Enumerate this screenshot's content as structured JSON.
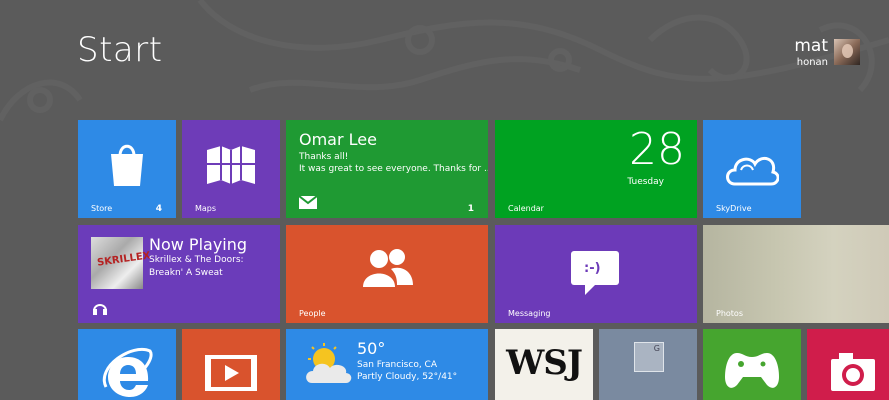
{
  "header": {
    "title": "Start",
    "user_name": "mat",
    "user_subtitle": "honan"
  },
  "tiles": {
    "store": {
      "label": "Store",
      "badge": "4"
    },
    "maps": {
      "label": "Maps"
    },
    "mail": {
      "sender": "Omar Lee",
      "subject": "Thanks all!",
      "preview": "It was great to see everyone. Thanks for ...",
      "badge": "1"
    },
    "calendar": {
      "label": "Calendar",
      "date": "28",
      "day": "Tuesday"
    },
    "skydrive": {
      "label": "SkyDrive"
    },
    "music": {
      "title": "Now Playing",
      "artist": "Skrillex & The Doors:",
      "track": "Breakn' A Sweat",
      "album_text": "SKRILLEX"
    },
    "people": {
      "label": "People"
    },
    "messaging": {
      "label": "Messaging",
      "emoticon": ":-)"
    },
    "photos": {
      "label": "Photos"
    },
    "weather": {
      "temp": "50°",
      "location": "San Francisco, CA",
      "condition": "Partly Cloudy, 52°/41°"
    },
    "wsj": {
      "text": "WSJ"
    },
    "news": {
      "glyph": "G"
    }
  },
  "colors": {
    "background": "#5b5b5b",
    "blue": "#2e8ae6",
    "purple": "#6c3ab8",
    "green": "#00a221",
    "orange": "#d9532d",
    "camera_red": "#d01d4b"
  }
}
